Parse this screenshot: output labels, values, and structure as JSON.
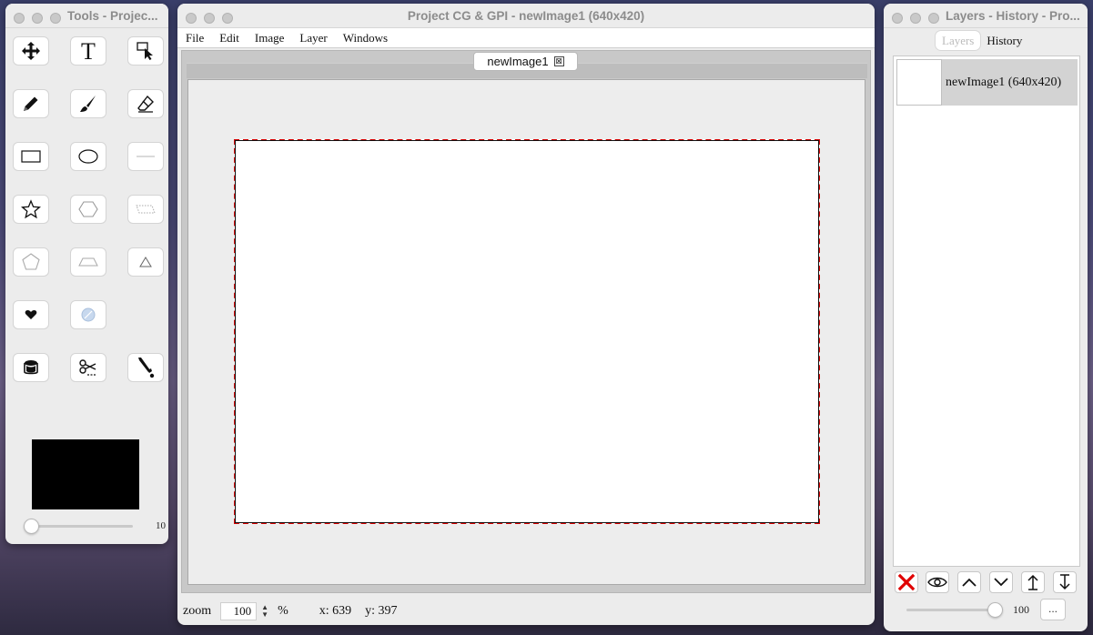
{
  "tools_window": {
    "title": "Tools - Projec...",
    "tools": [
      {
        "name": "move-tool",
        "icon": "move-arrows-icon"
      },
      {
        "name": "text-tool",
        "icon": "text-T-icon"
      },
      {
        "name": "select-tool",
        "icon": "select-pointer-icon"
      },
      {
        "name": "pencil-tool",
        "icon": "pencil-icon"
      },
      {
        "name": "brush-tool",
        "icon": "brush-icon"
      },
      {
        "name": "eraser-tool",
        "icon": "eraser-icon"
      },
      {
        "name": "rectangle-tool",
        "icon": "rectangle-icon"
      },
      {
        "name": "ellipse-tool",
        "icon": "ellipse-icon"
      },
      {
        "name": "line-tool",
        "icon": "line-icon"
      },
      {
        "name": "star-tool",
        "icon": "star-icon"
      },
      {
        "name": "hexagon-tool",
        "icon": "hexagon-icon"
      },
      {
        "name": "parallelogram-tool",
        "icon": "parallelogram-icon"
      },
      {
        "name": "pentagon-tool",
        "icon": "pentagon-icon"
      },
      {
        "name": "trapezoid-tool",
        "icon": "trapezoid-icon"
      },
      {
        "name": "triangle-tool",
        "icon": "triangle-icon"
      },
      {
        "name": "heart-tool",
        "icon": "heart-icon"
      },
      {
        "name": "circle-slash-tool",
        "icon": "circle-slash-icon"
      },
      {
        "name": "fill-bucket-tool",
        "icon": "bucket-icon"
      },
      {
        "name": "cut-tool",
        "icon": "scissors-icon"
      },
      {
        "name": "eyedropper-tool",
        "icon": "eyedropper-icon"
      }
    ],
    "color": "#000000",
    "brush_size": "10",
    "brush_size_level": 0.05
  },
  "main_window": {
    "title": "Project CG & GPI - newImage1 (640x420)",
    "menu": [
      "File",
      "Edit",
      "Image",
      "Layer",
      "Windows"
    ],
    "tab_label": "newImage1",
    "tab_close": "⊠",
    "status": {
      "zoom_label": "zoom",
      "zoom_value": "100",
      "zoom_unit": "%",
      "x_label": "x: 639",
      "y_label": "y: 397"
    }
  },
  "layers_window": {
    "title": "Layers - History - Pro...",
    "tabs": [
      "Layers",
      "History"
    ],
    "layers": [
      {
        "name": "newImage1 (640x420)"
      }
    ],
    "opacity_value": "100",
    "opacity_level": 1.0,
    "more_label": "..."
  },
  "colors": {
    "canvas_border": "#d40000",
    "delete_red": "#e00000",
    "selected_layer": "#d3d3d3"
  }
}
